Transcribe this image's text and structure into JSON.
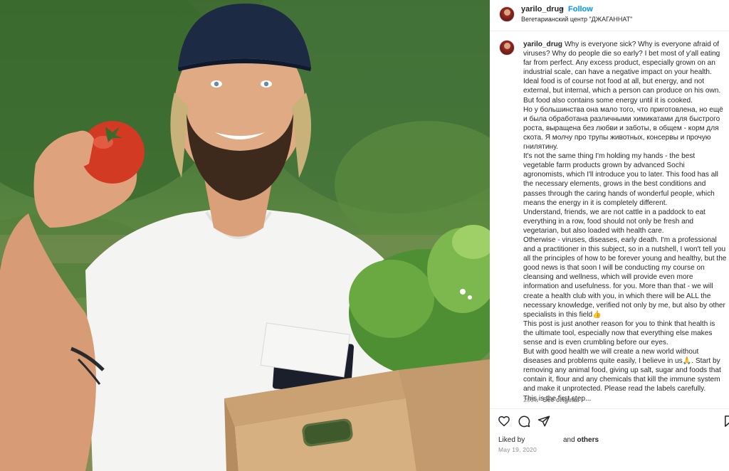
{
  "photo": {
    "alt_icon": "post-photo"
  },
  "header": {
    "username": "yarilo_drug",
    "separator": "•",
    "follow_label": "Follow",
    "location": "Вегетарианский центр \"ДЖАГАННАТ\""
  },
  "caption": {
    "username": "yarilo_drug",
    "text": "Why is everyone sick? Why is everyone afraid of viruses? Why do people die so early? I bet most of y'all eating far from perfect. Any excess product, especially grown on an industrial scale, can have a negative impact on your health. Ideal food is of course not food at all, but energy, and not external, but internal, which a person can produce on his own. But food also contains some energy until it is cooked.\nНо у большинства она мало того, что приготовлена, но ещё и была обработана различными химикатами для быстрого роста, выращена без любви и заботы, в общем - корм для скота. Я молчу про трупы животных, консервы и прочую гнилятину.\nIt's not the same thing I'm holding my hands - the best vegetable farm products grown by advanced Sochi agronomists, which I'll introduce you to later. This food has all the necessary elements, grows in the best conditions and passes through the caring hands of wonderful people, which means the energy in it is completely different.\nUnderstand, friends, we are not cattle in a paddock to eat everything in a row, food should not only be fresh and vegetarian, but also loaded with health care.\nOtherwise - viruses, diseases, early death. I'm a professional and a practitioner in this subject, so in a nutshell, I won't tell you all the principles of how to be forever young and healthy, but the good news is that soon I will be conducting my course on cleansing and wellness, which will provide even more information and usefulness. for you. More than that - we will create a health club with you, in which there will be ALL the necessary knowledge, verified not only by me, but also by other specialists in this field👍\nThis post is just another reason for you to think that health is the ultimate tool, especially now that everything else makes sense and is even crumbling before our eyes.\nBut with good health we will create a new world without diseases and problems quite easily, I believe in us🙏. Start by removing any animal food, giving up salt, sugar and foods that contain it, flour and any chemicals that kill the immune system and make it unprotected. Please read the labels carefully.\nThis is the first step..."
  },
  "meta": {
    "age": "203w",
    "see_original": "See original"
  },
  "actions": {
    "like_icon": "heart-icon",
    "comment_icon": "comment-icon",
    "share_icon": "share-icon",
    "save_icon": "bookmark-icon"
  },
  "likes": {
    "prefix": "Liked by",
    "suffix": "and others"
  },
  "date": "May 19, 2020",
  "colors": {
    "link_blue": "#0095f6",
    "text": "#262626",
    "muted": "#8e8e8e"
  }
}
